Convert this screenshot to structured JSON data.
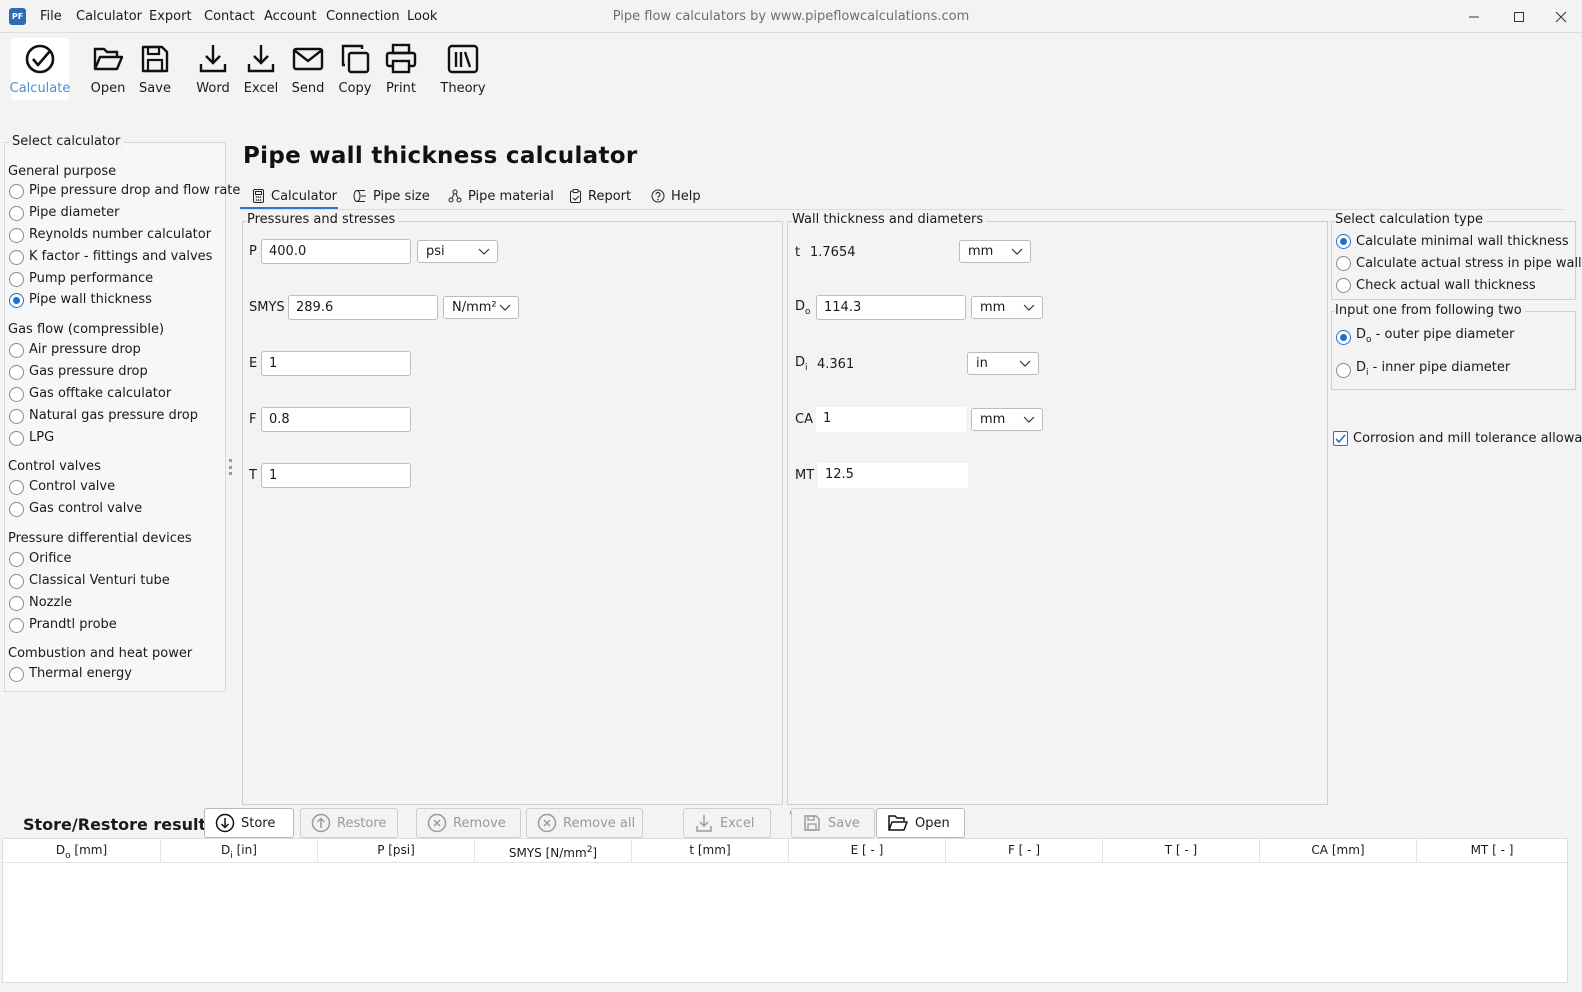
{
  "window": {
    "title": "Pipe flow calculators by www.pipeflowcalculations.com",
    "app_icon": "PF",
    "menu": [
      "File",
      "Calculator",
      "Export",
      "Contact",
      "Account",
      "Connection",
      "Look"
    ]
  },
  "toolbar": {
    "calculate": "Calculate",
    "open": "Open",
    "save": "Save",
    "word": "Word",
    "excel": "Excel",
    "send": "Send",
    "copy": "Copy",
    "print": "Print",
    "theory": "Theory"
  },
  "sidebar": {
    "title": "Select calculator",
    "groups": [
      {
        "label": "General purpose",
        "items": [
          "Pipe pressure drop and flow rate",
          "Pipe diameter",
          "Reynolds number calculator",
          "K factor - fittings and valves",
          "Pump performance",
          "Pipe wall thickness"
        ]
      },
      {
        "label": "Gas flow (compressible)",
        "items": [
          "Air pressure drop",
          "Gas pressure drop",
          "Gas offtake calculator",
          "Natural gas pressure drop",
          "LPG"
        ]
      },
      {
        "label": "Control valves",
        "items": [
          "Control valve",
          "Gas control valve"
        ]
      },
      {
        "label": "Pressure differential devices",
        "items": [
          "Orifice",
          "Classical Venturi tube",
          "Nozzle",
          "Prandtl probe"
        ]
      },
      {
        "label": "Combustion and heat power",
        "items": [
          "Thermal energy"
        ]
      }
    ],
    "selected": "Pipe wall thickness"
  },
  "page": {
    "title": "Pipe wall thickness calculator",
    "tabs": [
      "Calculator",
      "Pipe size",
      "Pipe material",
      "Report",
      "Help"
    ],
    "active_tab": "Calculator"
  },
  "pressures": {
    "title": "Pressures and stresses",
    "P": {
      "label": "P",
      "value": "400.0",
      "unit": "psi"
    },
    "SMYS": {
      "label": "SMYS",
      "value": "289.6",
      "unit": "N/mm²"
    },
    "E": {
      "label": "E",
      "value": "1"
    },
    "F": {
      "label": "F",
      "value": "0.8"
    },
    "T": {
      "label": "T",
      "value": "1"
    }
  },
  "wall": {
    "title": "Wall thickness and diameters",
    "t": {
      "label": "t",
      "value": "1.7654",
      "unit": "mm"
    },
    "Do": {
      "label": "D",
      "sub": "o",
      "value": "114.3",
      "unit": "mm"
    },
    "Di": {
      "label": "D",
      "sub": "i",
      "value": "4.361",
      "unit": "in"
    },
    "CA": {
      "label": "CA",
      "value": "1",
      "unit": "mm"
    },
    "MT": {
      "label": "MT",
      "value": "12.5"
    }
  },
  "calc_type": {
    "title": "Select calculation type",
    "options": [
      "Calculate minimal wall thickness",
      "Calculate actual stress in pipe wall",
      "Check actual wall thickness"
    ],
    "selected": "Calculate minimal wall thickness"
  },
  "input_choice": {
    "title": "Input one from following two",
    "outer": {
      "label": "D",
      "sub": "o",
      "rest": " - outer pipe diameter"
    },
    "inner": {
      "label": "D",
      "sub": "i",
      "rest": " - inner pipe diameter"
    },
    "selected": "outer"
  },
  "corrosion": {
    "label": "Corrosion and mill tolerance allowance",
    "checked": true
  },
  "store": {
    "title": "Store/Restore results",
    "buttons": {
      "store": "Store",
      "restore": "Restore",
      "remove": "Remove",
      "remove_all": "Remove all",
      "excel": "Excel",
      "save": "Save",
      "open": "Open"
    }
  },
  "results_table": {
    "columns": [
      {
        "label": "D",
        "sub": "o",
        "rest": " [mm]"
      },
      {
        "label": "D",
        "sub": "i",
        "rest": " [in]"
      },
      {
        "label": "P [psi]"
      },
      {
        "label": "SMYS [N/mm",
        "sup": "2",
        "rest": "]"
      },
      {
        "label": "t [mm]"
      },
      {
        "label": "E [ - ]"
      },
      {
        "label": "F [ - ]"
      },
      {
        "label": "T [ - ]"
      },
      {
        "label": "CA [mm]"
      },
      {
        "label": "MT [ - ]"
      }
    ],
    "rows": []
  },
  "colors": {
    "accent": "#1f6fd1",
    "tab_underline": "#2a78d1",
    "calculate_label": "#4a8fd6"
  }
}
